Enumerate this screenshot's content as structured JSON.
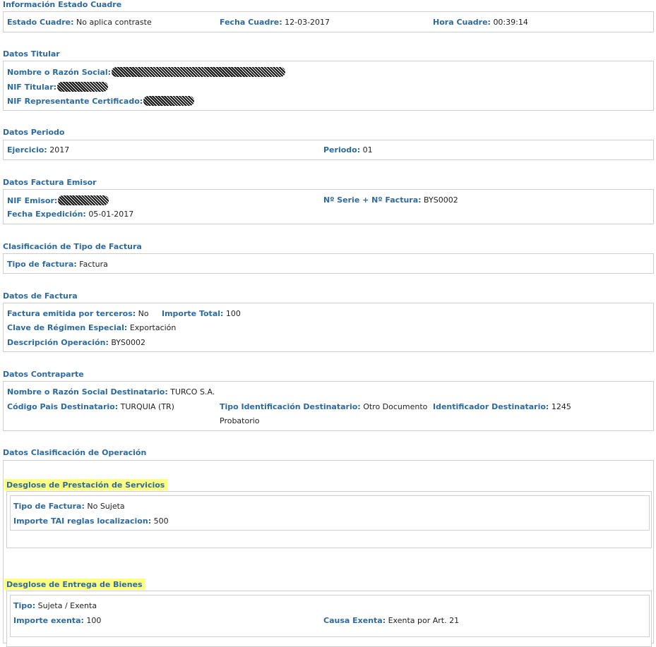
{
  "estado": {
    "title": "Información Estado Cuadre",
    "estado_label": "Estado Cuadre:",
    "estado_value": "No aplica contraste",
    "fecha_label": "Fecha Cuadre:",
    "fecha_value": "12-03-2017",
    "hora_label": "Hora Cuadre:",
    "hora_value": "00:39:14"
  },
  "titular": {
    "title": "Datos Titular",
    "nombre_label": "Nombre o Razón Social:",
    "nif_label": "NIF Titular:",
    "nif_rep_label": "NIF Representante Certificado:"
  },
  "periodo": {
    "title": "Datos Periodo",
    "ejercicio_label": "Ejercicio:",
    "ejercicio_value": "2017",
    "periodo_label": "Periodo:",
    "periodo_value": "01"
  },
  "emisor": {
    "title": "Datos Factura Emisor",
    "nif_label": "NIF Emisor:",
    "serie_label": "Nº Serie + Nº Factura:",
    "serie_value": "BYS0002",
    "fecha_label": "Fecha Expedición:",
    "fecha_value": "05-01-2017"
  },
  "clasificacion": {
    "title": "Clasificación de Tipo de Factura",
    "tipo_label": "Tipo de factura:",
    "tipo_value": "Factura"
  },
  "factura": {
    "title": "Datos de Factura",
    "terceros_label": "Factura emitida por terceros:",
    "terceros_value": "No",
    "importe_label": "Importe Total:",
    "importe_value": "100",
    "clave_label": "Clave de Régimen Especial:",
    "clave_value": "Exportación",
    "desc_label": "Descripción Operación:",
    "desc_value": "BYS0002"
  },
  "contraparte": {
    "title": "Datos Contraparte",
    "nombre_label": "Nombre o Razón Social Destinatario:",
    "nombre_value": "TURCO S.A.",
    "pais_label": "Código Pais Destinatario:",
    "pais_value": "TURQUIA (TR)",
    "tipo_id_label": "Tipo Identificación Destinatario:",
    "tipo_id_value_1": "Otro Documento",
    "tipo_id_value_2": "Probatorio",
    "id_label": "Identificador Destinatario:",
    "id_value": "1245"
  },
  "operacion": {
    "title": "Datos Clasificación de Operación",
    "servicios": {
      "title": "Desglose de Prestación de Servicios",
      "tipo_label": "Tipo de Factura:",
      "tipo_value": "No Sujeta",
      "importe_label": "Importe TAI reglas localizacion:",
      "importe_value": "500"
    },
    "bienes": {
      "title": "Desglose de Entrega de Bienes",
      "tipo_label": "Tipo:",
      "tipo_value": "Sujeta / Exenta",
      "importe_label": "Importe exenta:",
      "importe_value": "100",
      "causa_label": "Causa Exenta:",
      "causa_value": "Exenta por Art. 21"
    }
  },
  "colors": {
    "label": "#2c6aa0",
    "highlight": "#ffff80",
    "border": "#cfcfcf"
  }
}
